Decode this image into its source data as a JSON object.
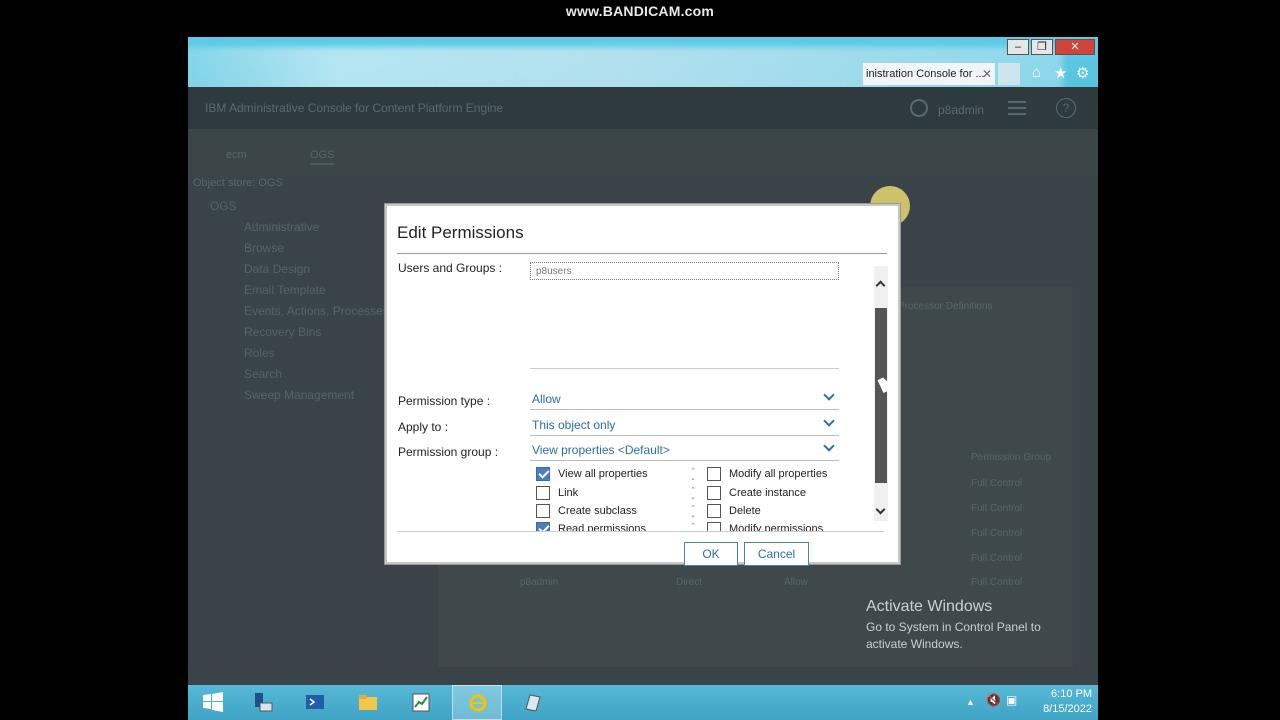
{
  "watermark": "www.BANDICAM.com",
  "browser": {
    "tab_title": "inistration Console for ...",
    "tab_close": "✕",
    "window_buttons": {
      "minimize": "–",
      "maximize": "❐",
      "close": "✕"
    }
  },
  "app": {
    "title": "IBM Administrative Console for Content Platform Engine",
    "username": "p8admin",
    "help": "?"
  },
  "background": {
    "breadcrumbs": [
      "ecm",
      "OGS"
    ],
    "object_store_label": "Object store: OGS",
    "tree_root": "OGS",
    "tree_items": [
      "Administrative",
      "Browse",
      "Data Design",
      "Email Template",
      "Events, Actions, Processes",
      "Recovery Bins",
      "Roles",
      "Search",
      "Sweep Management"
    ],
    "right_tab_label": "Processor Definitions",
    "column_header": "Permission Group",
    "rows": [
      "Full Control",
      "Full Control",
      "Full Control",
      "Full Control",
      "Full Control"
    ],
    "last_row": {
      "name": "p8admin",
      "source": "Direct",
      "type": "Allow"
    }
  },
  "activate_windows": {
    "title": "Activate Windows",
    "line1": "Go to System in Control Panel to",
    "line2": "activate Windows."
  },
  "dialog": {
    "title": "Edit Permissions",
    "users_groups_label": "Users and Groups :",
    "users_groups_value": "p8users",
    "permission_type_label": "Permission type :",
    "permission_type_value": "Allow",
    "apply_to_label": "Apply to :",
    "apply_to_value": "This object only",
    "permission_group_label": "Permission group :",
    "permission_group_value": "View properties <Default>",
    "permissions_left": [
      {
        "label": "View all properties",
        "checked": true
      },
      {
        "label": "Link",
        "checked": false
      },
      {
        "label": "Create subclass",
        "checked": false
      },
      {
        "label": "Read permissions",
        "checked": true
      }
    ],
    "permissions_right": [
      {
        "label": "Modify all properties",
        "checked": false
      },
      {
        "label": "Create instance",
        "checked": false
      },
      {
        "label": "Delete",
        "checked": false
      },
      {
        "label": "Modify permissions",
        "checked": false
      }
    ],
    "ok_label": "OK",
    "cancel_label": "Cancel"
  },
  "taskbar": {
    "time": "6:10 PM",
    "date": "8/15/2022"
  },
  "colors": {
    "accent": "#2d6ea6",
    "checkbox_checked": "#4a7fbf",
    "taskbar": "#4fb2d1"
  }
}
